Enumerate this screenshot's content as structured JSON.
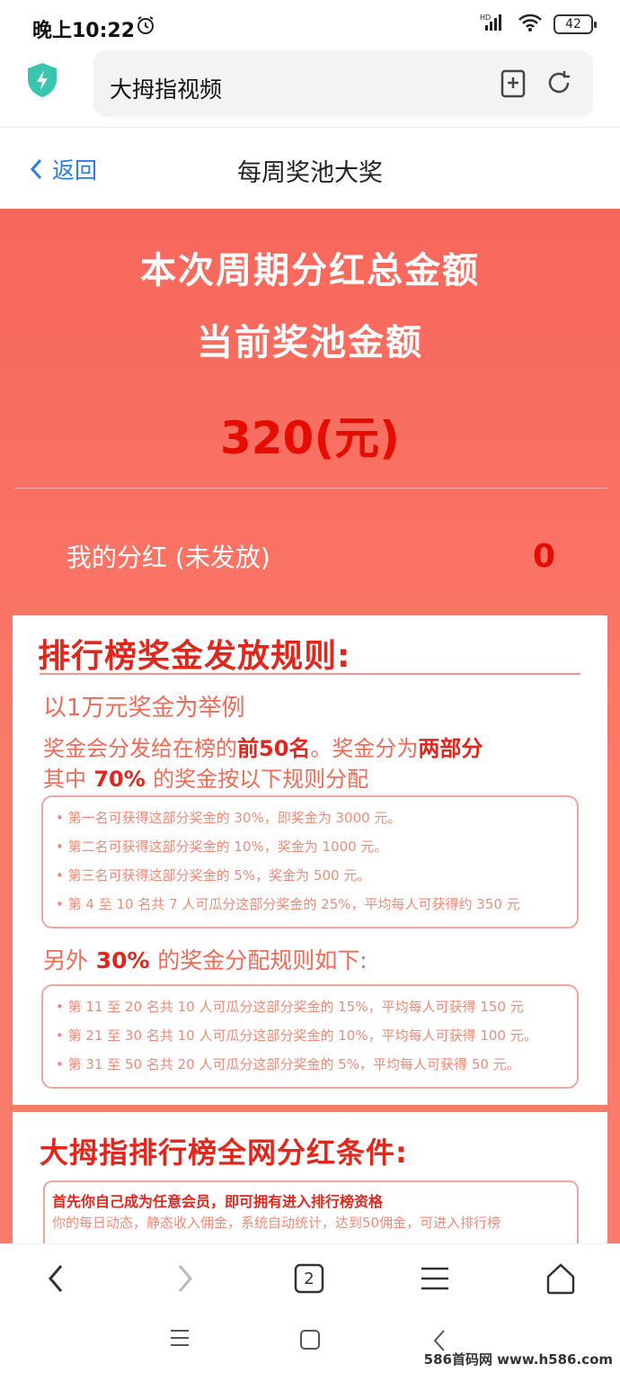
{
  "status": {
    "time": "晚上10:22",
    "battery": "42",
    "network": "HD"
  },
  "browser": {
    "url_title": "大拇指视频"
  },
  "header": {
    "back_label": "返回",
    "title": "每周奖池大奖"
  },
  "hero": {
    "line1": "本次周期分红总金额",
    "line2": "当前奖池金额",
    "amount": "320(元)",
    "my_dividend_label": "我的分红 (未发放)",
    "my_dividend_value": "0"
  },
  "rules": {
    "title": "排行榜奖金发放规则:",
    "example": "以1万元奖金为举例",
    "line2_a": "奖金会分发给在榜的",
    "line2_b": "前50名",
    "line2_c": "。奖金分为",
    "line2_d": "两部分",
    "line3_a": "其中",
    "line3_b": " 70% ",
    "line3_c": "的奖金按以下规则分配",
    "part1": [
      "• 第一名可获得这部分奖金的 30%，即奖金为 3000 元。",
      "• 第二名可获得这部分奖金的 10%，奖金为 1000 元。",
      "• 第三名可获得这部分奖金的 5%，奖金为 500 元。",
      "• 第 4 至 10 名共 7 人可瓜分这部分奖金的 25%，平均每人可获得约 350 元"
    ],
    "other_a": "另外",
    "other_b": " 30% ",
    "other_c": "的奖金分配规则如下:",
    "part2": [
      "• 第 11 至 20 名共 10 人可瓜分这部分奖金的 15%，平均每人可获得 150 元",
      "• 第 21 至 30 名共 10 人可瓜分这部分奖金的 10%，平均每人可获得 100 元。",
      "• 第 31 至 50 名共 20 人可瓜分这部分奖金的 5%，平均每人可获得 50 元。"
    ]
  },
  "conditions": {
    "title": "大拇指排行榜全网分红条件:",
    "line1": "首先你自己成为任意会员，即可拥有进入排行榜资格",
    "line2": "你的每日动态，静态收入佣金，系统自动统计，达到50佣金，可进入排行榜"
  },
  "bottom_nav": {
    "tabs_count": "2"
  },
  "watermark": "586首码网 www.h586.com",
  "colors": {
    "accent_red": "#e3261c",
    "hero_bg": "#f7675c",
    "link_blue": "#2c7be5"
  }
}
